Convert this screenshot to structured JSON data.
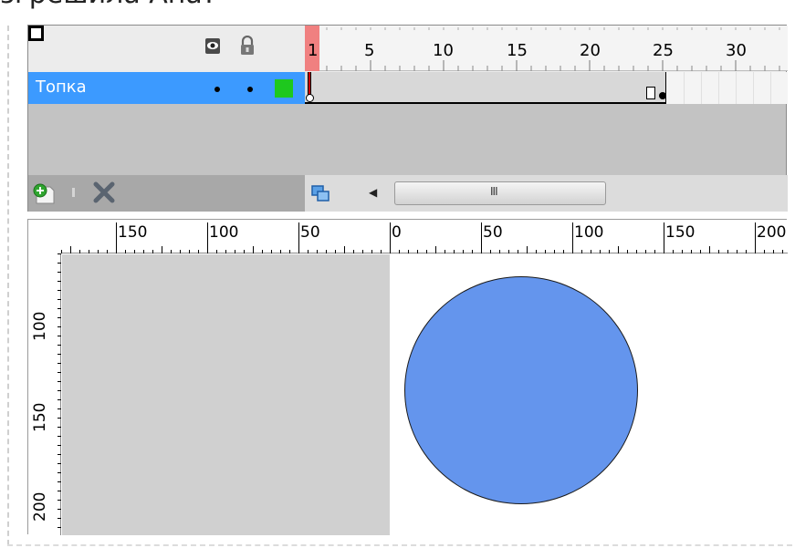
{
  "caption": "згрешила Ана?",
  "timeline": {
    "playhead_frame": "1",
    "frame_numbers": [
      "5",
      "10",
      "15",
      "20",
      "25",
      "30"
    ],
    "layer": {
      "name": "Топка",
      "color": "#1ec81e"
    },
    "icons": {
      "visibility": "eye-icon",
      "lock": "lock-icon",
      "outline": "outline-icon",
      "add_layer": "add-layer-icon",
      "delete_layer": "delete-icon",
      "onion_skin": "onion-skin-icon",
      "scroll_left": "chevron-left-icon",
      "scroll_grip": "grip-icon"
    },
    "scroll_left_glyph": "◀",
    "scroll_grip_glyph": "III"
  },
  "stage": {
    "h_ruler_labels": [
      "150",
      "100",
      "50",
      "0",
      "50",
      "100",
      "150",
      "200"
    ],
    "v_ruler_labels": [
      "100",
      "150",
      "200"
    ],
    "shape": {
      "type": "circle",
      "fill": "#6495ed",
      "stroke": "#1a1a1a"
    }
  },
  "colors": {
    "layer_selected": "#3c9aff",
    "playhead": "#f08080",
    "pasteboard": "#d0d0d0"
  }
}
